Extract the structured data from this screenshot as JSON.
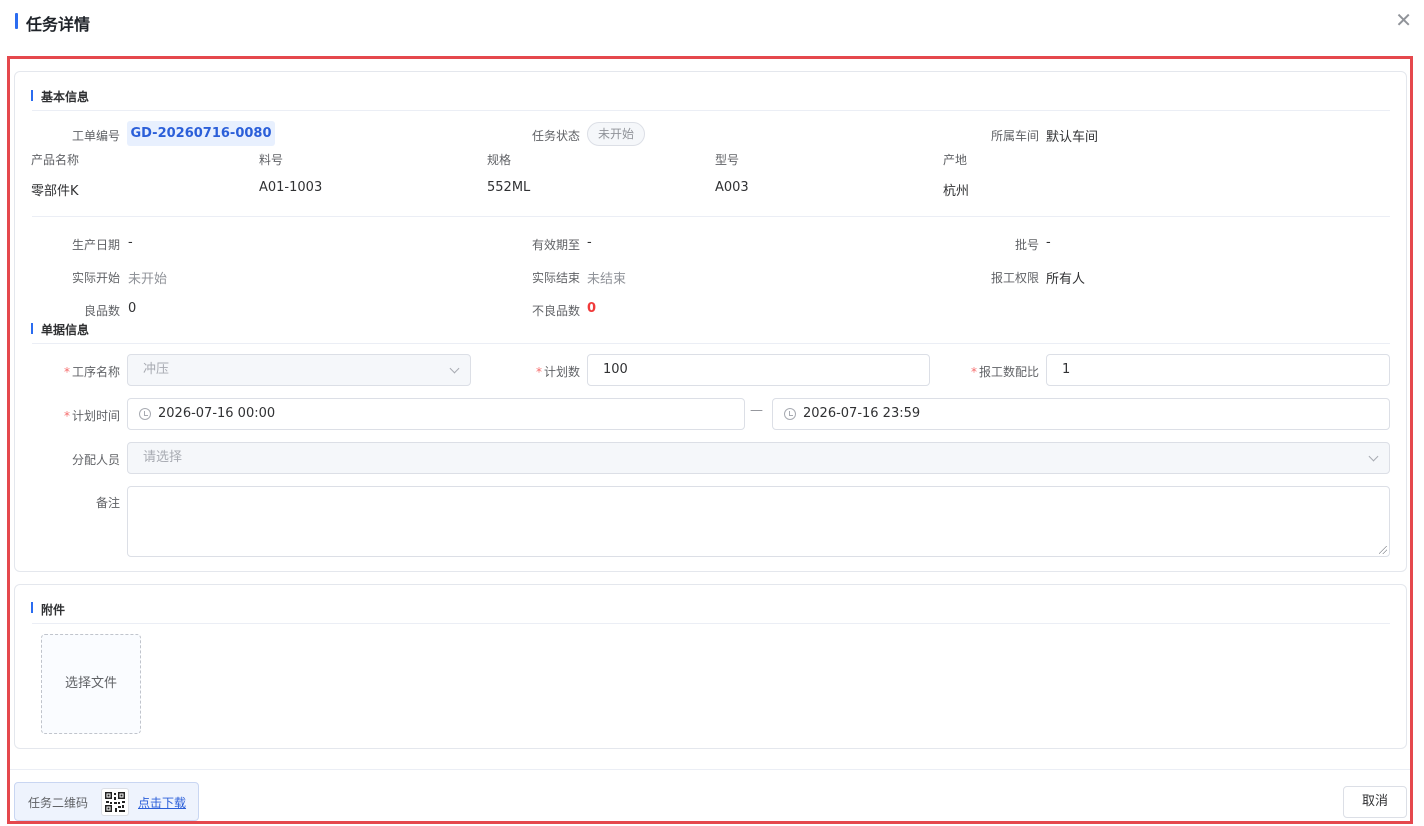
{
  "dialog": {
    "title": "任务详情",
    "close_icon": "close-icon"
  },
  "basic": {
    "section_title": "基本信息",
    "order_no_label": "工单编号",
    "order_no": "GD-20260716-0080",
    "status_label": "任务状态",
    "status": "未开始",
    "workshop_label": "所属车间",
    "workshop": "默认车间",
    "columns": [
      {
        "label": "产品名称",
        "value": "零部件K"
      },
      {
        "label": "料号",
        "value": "A01-1003"
      },
      {
        "label": "规格",
        "value": "552ML"
      },
      {
        "label": "型号",
        "value": "A003"
      },
      {
        "label": "产地",
        "value": "杭州"
      }
    ],
    "prod_date_label": "生产日期",
    "prod_date": "-",
    "expire_label": "有效期至",
    "expire": "-",
    "batch_label": "批号",
    "batch": "-",
    "actual_start_label": "实际开始",
    "actual_start": "未开始",
    "actual_end_label": "实际结束",
    "actual_end": "未结束",
    "report_perm_label": "报工权限",
    "report_perm": "所有人",
    "good_label": "良品数",
    "good": "0",
    "bad_label": "不良品数",
    "bad": "0"
  },
  "form": {
    "section_title": "单据信息",
    "required_mark": "*",
    "process_label": "工序名称",
    "process_value": "冲压",
    "plan_qty_label": "计划数",
    "plan_qty": "100",
    "ratio_label": "报工数配比",
    "ratio": "1",
    "plan_time_label": "计划时间",
    "plan_start": "2026-07-16 00:00",
    "plan_end": "2026-07-16 23:59",
    "range_sep": "—",
    "assignee_label": "分配人员",
    "assignee_placeholder": "请选择",
    "remark_label": "备注"
  },
  "attach": {
    "section_title": "附件",
    "upload_label": "选择文件"
  },
  "footer": {
    "qr_label": "任务二维码",
    "qr_link": "点击下载",
    "cancel": "取消"
  }
}
